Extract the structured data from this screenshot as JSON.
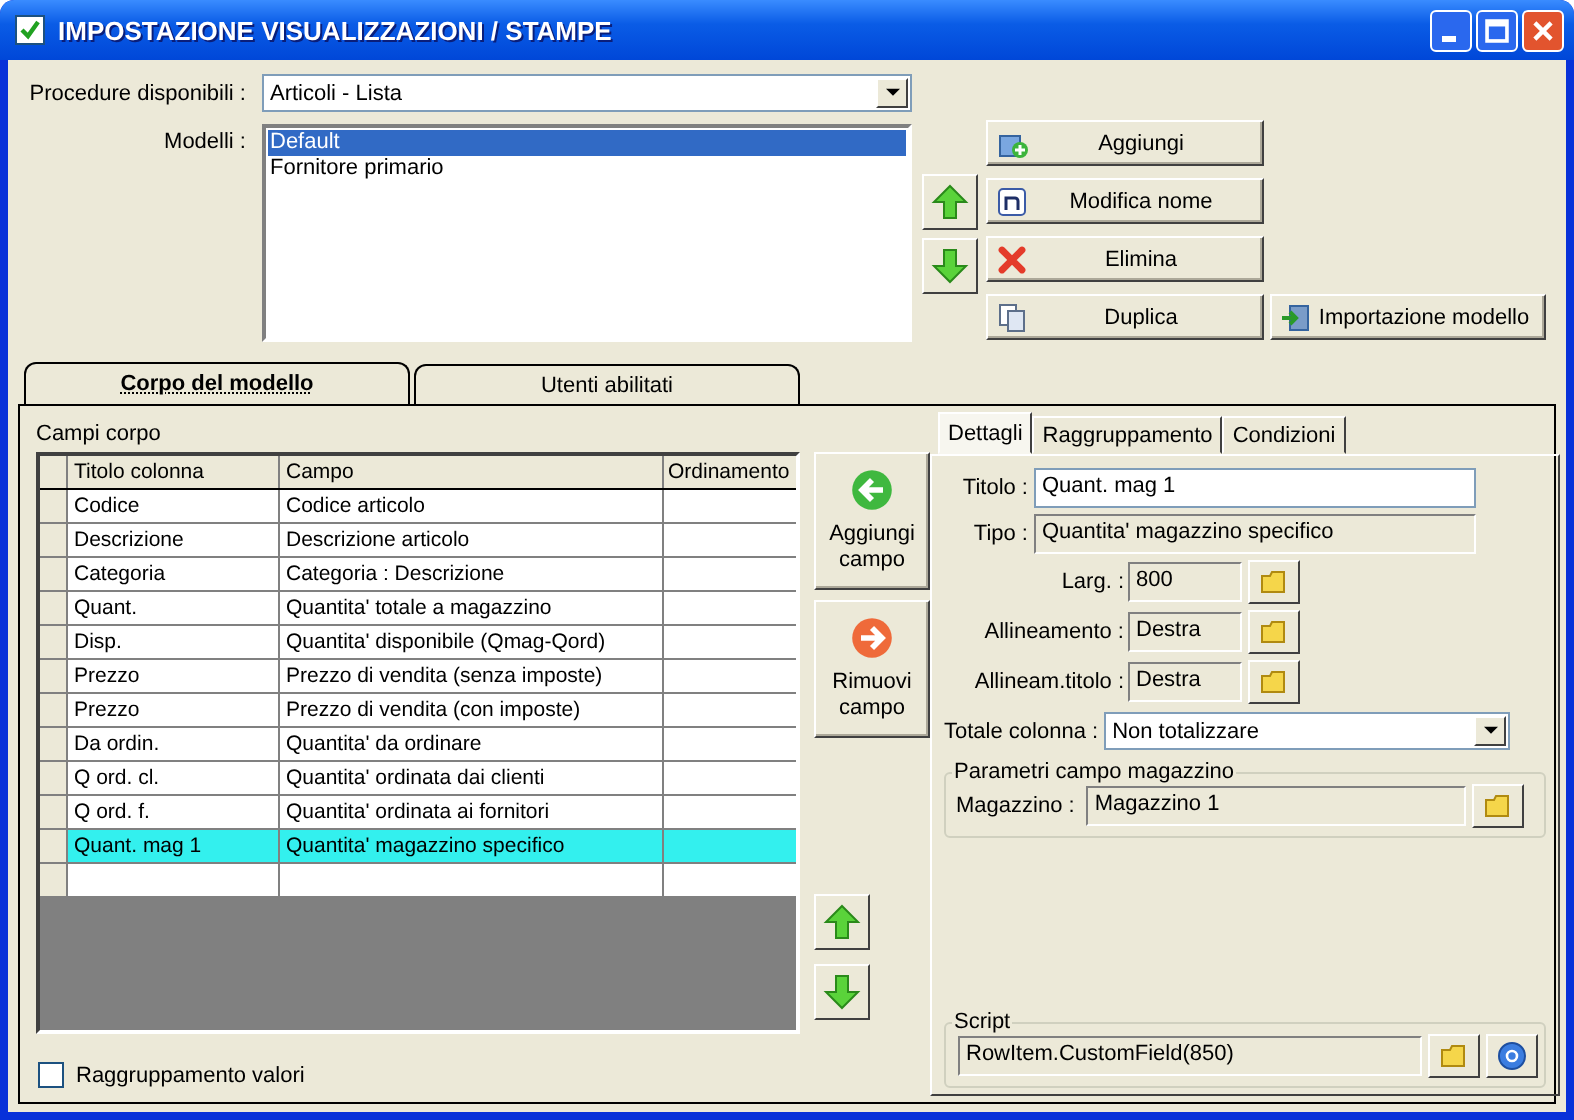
{
  "window": {
    "title": "IMPOSTAZIONE VISUALIZZAZIONI / STAMPE"
  },
  "procedure": {
    "label": "Procedure disponibili :",
    "value": "Articoli - Lista"
  },
  "models": {
    "label": "Modelli :",
    "items": [
      {
        "name": "Default",
        "selected": true
      },
      {
        "name": "Fornitore primario",
        "selected": false
      }
    ]
  },
  "model_buttons": [
    {
      "kind": "add",
      "label": "Aggiungi"
    },
    {
      "kind": "rename",
      "label": "Modifica nome"
    },
    {
      "kind": "delete",
      "label": "Elimina"
    },
    {
      "kind": "duplicate",
      "label": "Duplica"
    }
  ],
  "import_button": {
    "label": "Importazione modello"
  },
  "tabs": [
    {
      "label": "Corpo del modello",
      "selected": true
    },
    {
      "label": "Utenti abilitati",
      "selected": false
    }
  ],
  "body_fields": {
    "label": "Campi corpo",
    "columns": [
      "Titolo colonna",
      "Campo",
      "Ordinamento"
    ],
    "rows": [
      {
        "title": "Codice",
        "field": "Codice articolo",
        "selected": false
      },
      {
        "title": "Descrizione",
        "field": "Descrizione articolo",
        "selected": false
      },
      {
        "title": "Categoria",
        "field": "Categoria : Descrizione",
        "selected": false
      },
      {
        "title": "Quant.",
        "field": "Quantita' totale a magazzino",
        "selected": false
      },
      {
        "title": "Disp.",
        "field": "Quantita' disponibile (Qmag-Qord)",
        "selected": false
      },
      {
        "title": "Prezzo",
        "field": "Prezzo di vendita (senza imposte)",
        "selected": false
      },
      {
        "title": "Prezzo",
        "field": "Prezzo di vendita (con imposte)",
        "selected": false
      },
      {
        "title": "Da ordin.",
        "field": "Quantita' da ordinare",
        "selected": false
      },
      {
        "title": "Q ord. cl.",
        "field": "Quantita' ordinata dai clienti",
        "selected": false
      },
      {
        "title": "Q ord. f.",
        "field": "Quantita' ordinata ai fornitori",
        "selected": false
      },
      {
        "title": "Quant. mag 1",
        "field": "Quantita' magazzino specifico",
        "selected": true
      }
    ]
  },
  "field_buttons": [
    {
      "kind": "add",
      "label": "Aggiungi campo"
    },
    {
      "kind": "remove",
      "label": "Rimuovi campo"
    }
  ],
  "grouping_checkbox": {
    "label": "Raggruppamento valori",
    "checked": false
  },
  "detail_tabs": [
    {
      "label": "Dettagli",
      "selected": true
    },
    {
      "label": "Raggruppamento",
      "selected": false
    },
    {
      "label": "Condizioni",
      "selected": false
    }
  ],
  "detail_fields": [
    {
      "kind": "input",
      "label": "Titolo :",
      "value": "Quant. mag 1"
    },
    {
      "kind": "readonly",
      "label": "Tipo :",
      "value": "Quantita' magazzino specifico"
    },
    {
      "kind": "browse",
      "label": "Larg. :",
      "value": "800"
    },
    {
      "kind": "browse",
      "label": "Allineamento :",
      "value": "Destra"
    },
    {
      "kind": "browse",
      "label": "Allineam.titolo :",
      "value": "Destra"
    },
    {
      "kind": "select",
      "label": "Totale colonna :",
      "value": "Non totalizzare"
    }
  ],
  "warehouse_group": {
    "legend": "Parametri campo magazzino",
    "label": "Magazzino :",
    "value": "Magazzino 1"
  },
  "script_group": {
    "legend": "Script",
    "value": "RowItem.CustomField(850)"
  }
}
